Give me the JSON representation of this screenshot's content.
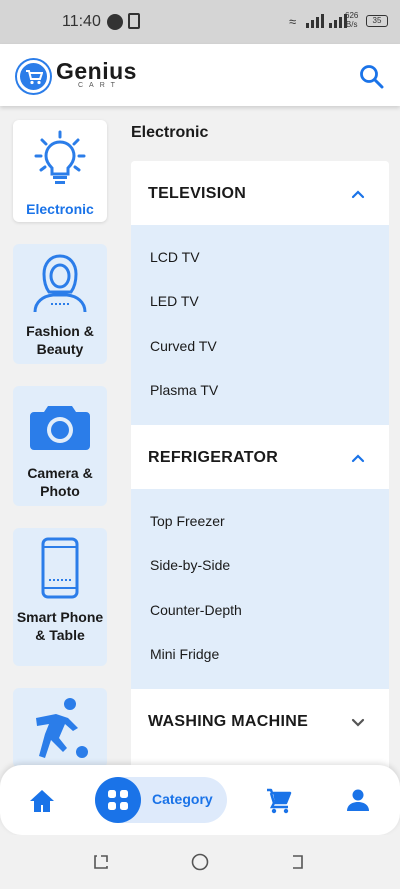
{
  "status_bar": {
    "time": "11:40",
    "speed_value": "626",
    "speed_unit": "B/s",
    "battery": "35"
  },
  "header": {
    "brand": "Genius",
    "brand_sub": "CART"
  },
  "sidebar": {
    "categories": [
      {
        "label": "Electronic",
        "icon": "lightbulb-icon",
        "active": true
      },
      {
        "label": "Fashion & Beauty",
        "icon": "woman-icon",
        "active": false
      },
      {
        "label": "Camera & Photo",
        "icon": "camera-icon",
        "active": false
      },
      {
        "label": "Smart Phone & Table",
        "icon": "smartphone-icon",
        "active": false
      },
      {
        "label": "",
        "icon": "soccer-player-icon",
        "active": false
      }
    ]
  },
  "content": {
    "title": "Electronic",
    "groups": [
      {
        "title": "TELEVISION",
        "expanded": true,
        "items": [
          "LCD TV",
          "LED TV",
          "Curved TV",
          "Plasma TV"
        ]
      },
      {
        "title": "REFRIGERATOR",
        "expanded": true,
        "items": [
          "Top Freezer",
          "Side-by-Side",
          "Counter-Depth",
          "Mini Fridge"
        ]
      },
      {
        "title": "WASHING MACHINE",
        "expanded": false,
        "items": []
      }
    ]
  },
  "bottom_nav": {
    "category_label": "Category"
  },
  "colors": {
    "accent": "#1a73e8",
    "tile_bg": "#e1edfa",
    "status_bar_bg": "#d5d5d5"
  }
}
